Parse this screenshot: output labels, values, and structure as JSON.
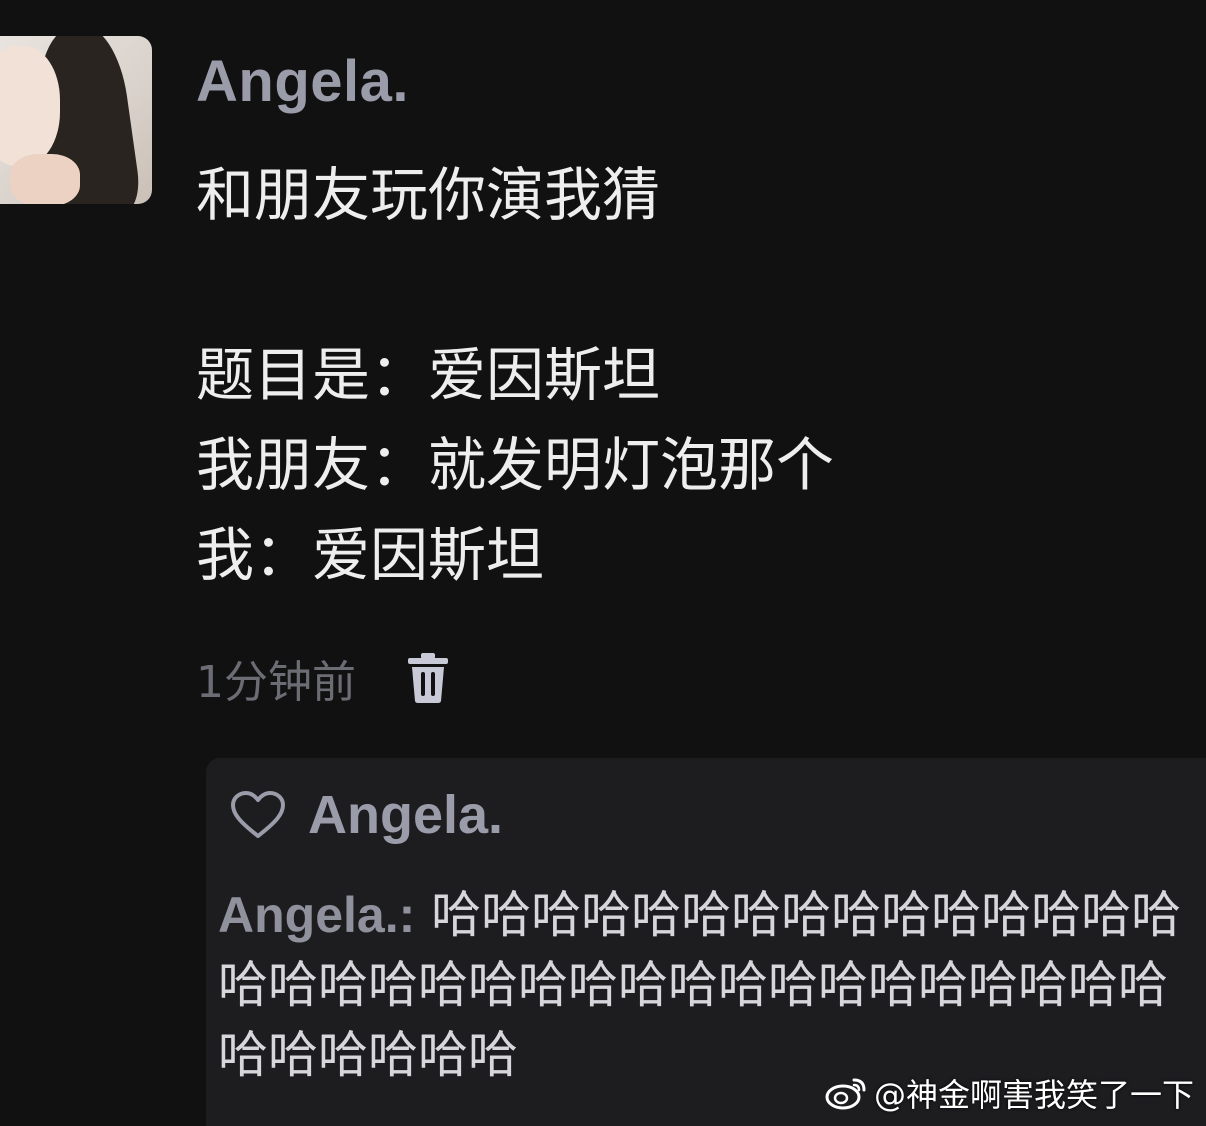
{
  "post": {
    "author": "Angela.",
    "lines": [
      "和朋友玩你演我猜",
      "",
      "题目是：爱因斯坦",
      "我朋友：就发明灯泡那个",
      "我：爱因斯坦"
    ],
    "timestamp": "1分钟前"
  },
  "reply": {
    "liked_by": "Angela.",
    "author": "Angela.",
    "separator": ":",
    "text": "哈哈哈哈哈哈哈哈哈哈哈哈哈哈哈哈哈哈哈哈哈哈哈哈哈哈哈哈哈哈哈哈哈哈哈哈哈哈哈哈"
  },
  "watermark": {
    "text": "@神金啊害我笑了一下"
  },
  "colors": {
    "background": "#111112",
    "username": "#9a9caa",
    "body_text": "#eeeeee",
    "muted": "#6b6c74",
    "reply_bg": "#1d1d20"
  },
  "icons": [
    "trash-icon",
    "heart-icon",
    "weibo-logo-icon"
  ]
}
